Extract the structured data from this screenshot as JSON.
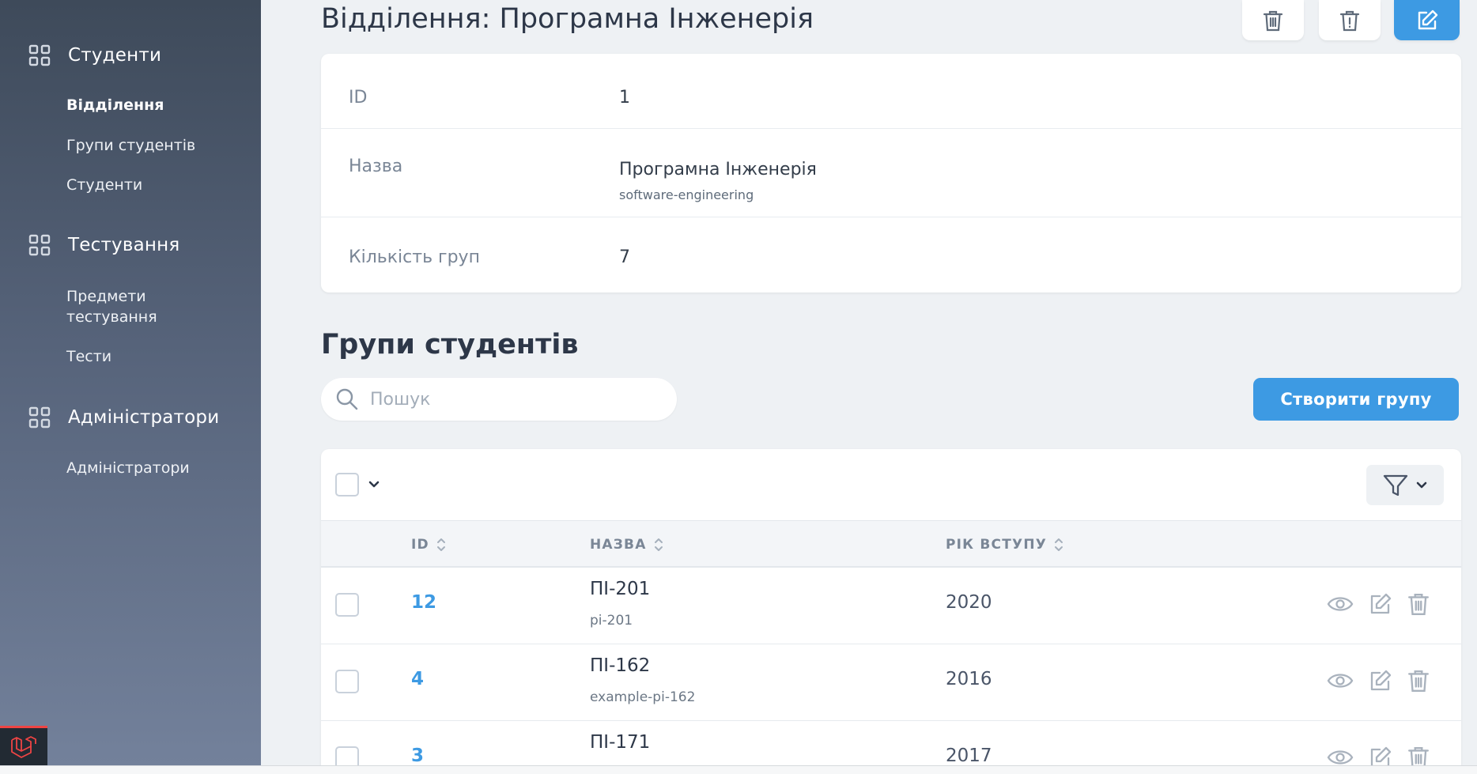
{
  "sidebar": {
    "sections": [
      {
        "label": "Студенти",
        "icon": "grid-icon",
        "items": [
          {
            "label": "Відділення",
            "active": true
          },
          {
            "label": "Групи студентів",
            "active": false
          },
          {
            "label": "Студенти",
            "active": false
          }
        ]
      },
      {
        "label": "Тестування",
        "icon": "grid-icon",
        "items": [
          {
            "label": "Предмети тестування",
            "active": false
          },
          {
            "label": "Тести",
            "active": false
          }
        ]
      },
      {
        "label": "Адміністратори",
        "icon": "grid-icon",
        "items": [
          {
            "label": "Адміністратори",
            "active": false
          }
        ]
      }
    ]
  },
  "header": {
    "title": "Відділення: Програмна Інженерія",
    "actions": [
      "trash-icon",
      "trash-alert-icon",
      "edit-icon"
    ]
  },
  "details": {
    "id_label": "ID",
    "id_value": "1",
    "name_label": "Назва",
    "name_value": "Програмна Інженерія",
    "name_slug": "software-engineering",
    "groups_label": "Кількість груп",
    "groups_value": "7"
  },
  "groups": {
    "title": "Групи студентів",
    "search_placeholder": "Пошук",
    "create_label": "Створити групу",
    "columns": {
      "id": "ID",
      "name": "НАЗВА",
      "year": "РІК ВСТУПУ"
    },
    "rows": [
      {
        "id": "12",
        "name": "ПІ-201",
        "slug": "pi-201",
        "year": "2020"
      },
      {
        "id": "4",
        "name": "ПІ-162",
        "slug": "example-pi-162",
        "year": "2016"
      },
      {
        "id": "3",
        "name": "ПІ-171",
        "slug": "",
        "year": "2017"
      }
    ]
  },
  "colors": {
    "accent": "#3d9ae3",
    "sidebar_top": "#3e4a5a",
    "sidebar_bottom": "#73819b",
    "background": "#eef1f4"
  }
}
